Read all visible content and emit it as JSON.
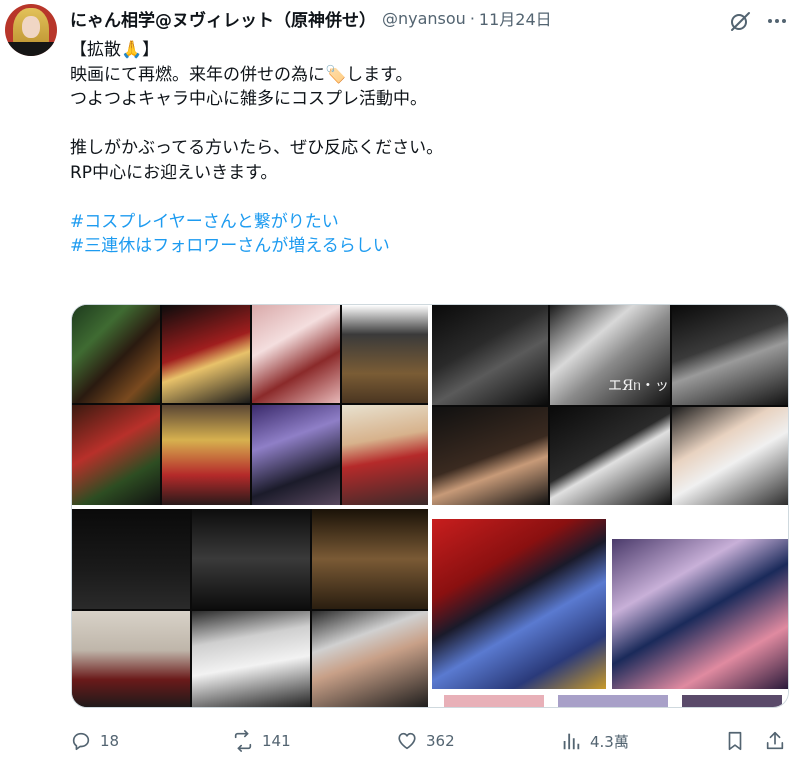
{
  "post": {
    "display_name": "にゃん相学@ヌヴィレット（原神併せ）",
    "handle": "@nyansou",
    "separator": "·",
    "date": "11月24日",
    "lines": [
      "【拡散🙏】",
      "映画にて再燃。来年の併せの為に🏷️します。",
      "つよつよキャラ中心に雑多にコスプレ活動中。",
      "",
      "推しがかぶってる方いたら、ぜひ反応ください。",
      "RP中心にお迎えいきます。",
      ""
    ],
    "hashtags": [
      "#コスプレイヤーさんと繋がりたい",
      "#三連休はフォロワーさんが増えるらしい"
    ],
    "image_text": "エЯᥒ・ッ"
  },
  "actions": {
    "replies": "18",
    "reposts": "141",
    "likes": "362",
    "views": "4.3萬"
  },
  "icons": [
    "grok-icon",
    "more-icon",
    "reply-icon",
    "repost-icon",
    "like-icon",
    "views-icon",
    "bookmark-icon",
    "share-icon"
  ],
  "colors": {
    "link": "#1d9bf0",
    "secondary": "#536471",
    "text": "#0f1419"
  }
}
